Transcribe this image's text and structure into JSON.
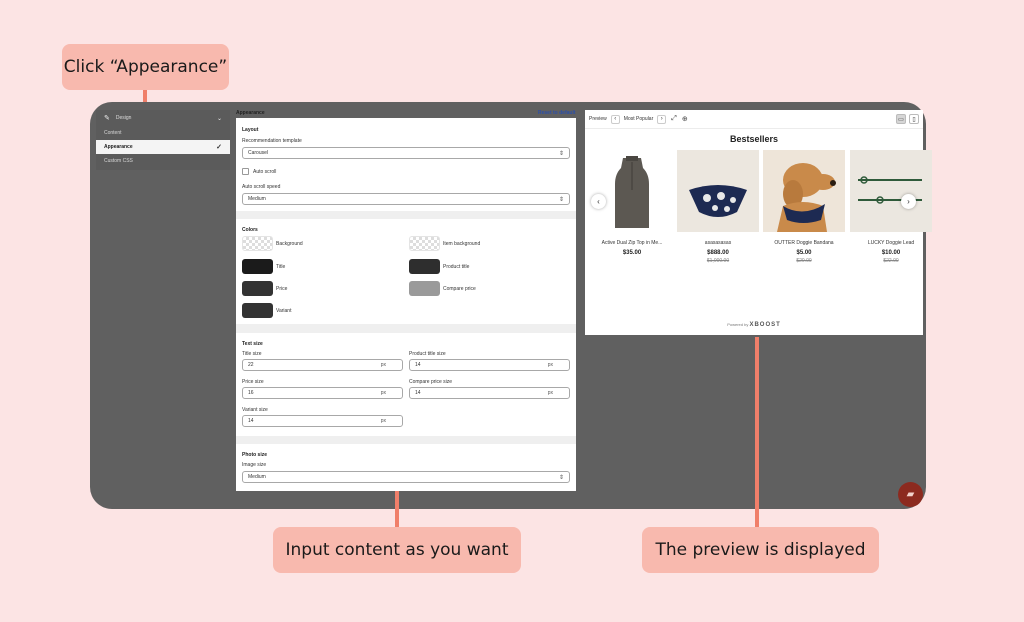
{
  "callouts": {
    "appearance": "Click “Appearance”",
    "input": "Input content as you want",
    "preview": "The preview is displayed"
  },
  "sidebar": {
    "section": "Design",
    "items": [
      {
        "label": "Content"
      },
      {
        "label": "Appearance",
        "active": true
      },
      {
        "label": "Custom CSS"
      }
    ]
  },
  "settings": {
    "title": "Appearance",
    "reset": "Reset to default",
    "layout": {
      "title": "Layout",
      "template_label": "Recommendation template",
      "template_value": "Carousel",
      "auto_scroll_label": "Auto scroll",
      "speed_label": "Auto scroll speed",
      "speed_value": "Medium"
    },
    "colors": {
      "title": "Colors",
      "items": [
        {
          "label": "Background",
          "color": "transparent"
        },
        {
          "label": "Item background",
          "color": "transparent"
        },
        {
          "label": "Title",
          "color": "#1b1b1b"
        },
        {
          "label": "Product title",
          "color": "#2e2e2e"
        },
        {
          "label": "Price",
          "color": "#333333"
        },
        {
          "label": "Compare price",
          "color": "#9a9a9a"
        },
        {
          "label": "Variant",
          "color": "#333333"
        }
      ]
    },
    "text_size": {
      "title": "Text size",
      "fields": [
        {
          "label": "Title size",
          "value": "22",
          "unit": "px"
        },
        {
          "label": "Product title size",
          "value": "14",
          "unit": "px"
        },
        {
          "label": "Price size",
          "value": "16",
          "unit": "px"
        },
        {
          "label": "Compare price size",
          "value": "14",
          "unit": "px"
        },
        {
          "label": "Variant size",
          "value": "14",
          "unit": "px"
        }
      ]
    },
    "photo_size": {
      "title": "Photo size",
      "image_label": "Image size",
      "image_value": "Medium"
    }
  },
  "preview": {
    "label": "Preview",
    "select": "Most Popular",
    "heading": "Bestsellers",
    "products": [
      {
        "name": "Active Dual Zip Top in Me...",
        "price": "$35.00",
        "compare": ""
      },
      {
        "name": "asasasasas",
        "price": "$888.00",
        "compare": "$1,000.00"
      },
      {
        "name": "OUTTER Doggie Bandana",
        "price": "$5.00",
        "compare": "$20.00"
      },
      {
        "name": "LUCKY Doggie Lead",
        "price": "$10.00",
        "compare": "$22.00"
      }
    ],
    "powered_by": "Powered by",
    "brand": "XBOOST"
  },
  "colors": {
    "accent_callout": "#f8b9ae",
    "connector": "#f07f6a",
    "background": "#fce4e4",
    "app_background": "#606060",
    "chat_button": "#8c2a1f"
  }
}
